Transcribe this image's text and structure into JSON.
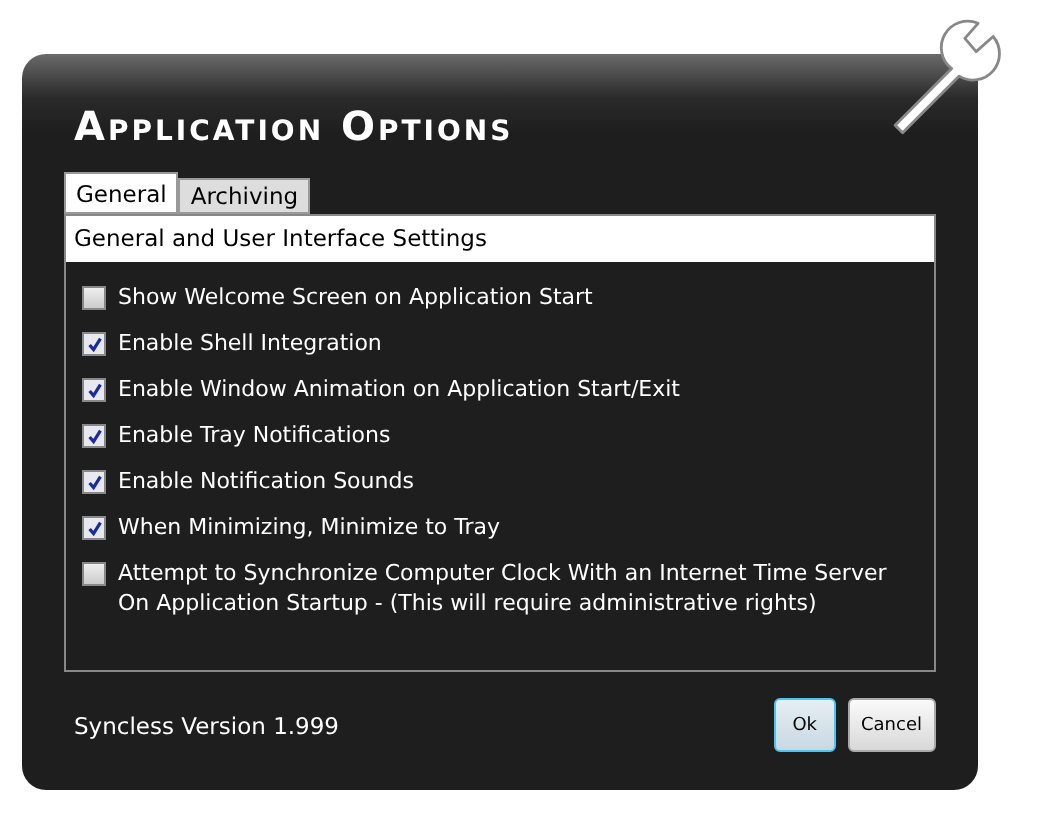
{
  "window": {
    "title": "Application Options"
  },
  "tabs": [
    {
      "label": "General",
      "selected": true
    },
    {
      "label": "Archiving",
      "selected": false
    }
  ],
  "section": {
    "title": "General and User Interface Settings"
  },
  "options": [
    {
      "label": "Show Welcome Screen on Application Start",
      "checked": false
    },
    {
      "label": "Enable Shell Integration",
      "checked": true
    },
    {
      "label": "Enable Window Animation on Application Start/Exit",
      "checked": true
    },
    {
      "label": "Enable Tray Notifications",
      "checked": true
    },
    {
      "label": "Enable Notification Sounds",
      "checked": true
    },
    {
      "label": "When Minimizing, Minimize to Tray",
      "checked": true
    },
    {
      "label": "Attempt to Synchronize Computer Clock With an Internet Time Server On Application Startup - (This will require administrative rights)",
      "checked": false
    }
  ],
  "footer": {
    "version": "Syncless Version 1.999"
  },
  "buttons": [
    {
      "label": "Ok",
      "kind": "default"
    },
    {
      "label": "Cancel",
      "kind": "normal"
    }
  ]
}
